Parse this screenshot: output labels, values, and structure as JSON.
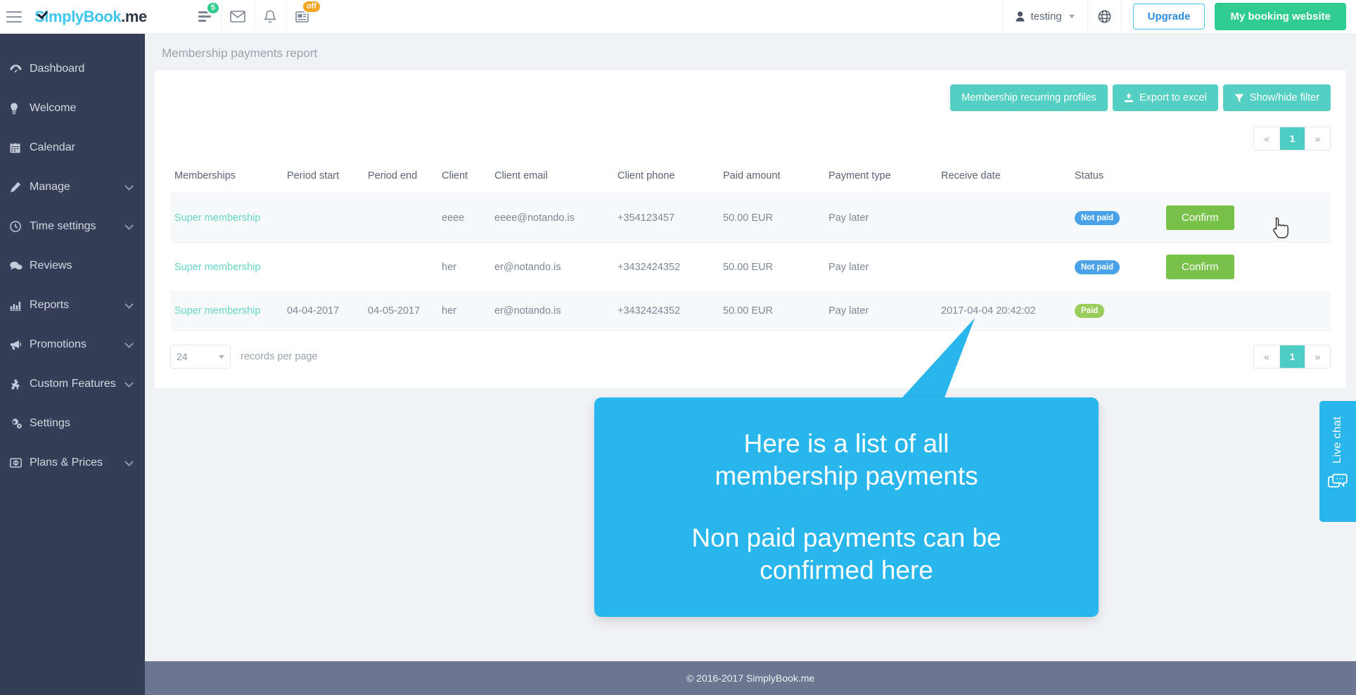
{
  "header": {
    "logo": {
      "s": "S",
      "blue": "imply",
      "bold_blue": "Book",
      "dark": ".me"
    },
    "icons": [
      {
        "name": "list-icon",
        "badge": "5",
        "badge_color": "#2ecc8f"
      },
      {
        "name": "envelope-icon",
        "badge": ""
      },
      {
        "name": "bell-icon",
        "badge": ""
      },
      {
        "name": "news-icon",
        "badge": "off",
        "badge_color": "#f5a623"
      }
    ],
    "user": "testing",
    "upgrade_label": "Upgrade",
    "booking_label": "My booking website"
  },
  "sidebar": {
    "items": [
      {
        "label": "Dashboard",
        "icon": "dashboard-icon",
        "chevron": false
      },
      {
        "label": "Welcome",
        "icon": "bulb-icon",
        "chevron": false
      },
      {
        "label": "Calendar",
        "icon": "calendar-icon",
        "chevron": false
      },
      {
        "label": "Manage",
        "icon": "pencil-icon",
        "chevron": true
      },
      {
        "label": "Time settings",
        "icon": "clock-icon",
        "chevron": true
      },
      {
        "label": "Reviews",
        "icon": "comment-icon",
        "chevron": false
      },
      {
        "label": "Reports",
        "icon": "chart-icon",
        "chevron": true
      },
      {
        "label": "Promotions",
        "icon": "megaphone-icon",
        "chevron": true
      },
      {
        "label": "Custom Features",
        "icon": "puzzle-icon",
        "chevron": true
      },
      {
        "label": "Settings",
        "icon": "gears-icon",
        "chevron": false
      },
      {
        "label": "Plans & Prices",
        "icon": "card-icon",
        "chevron": true
      }
    ]
  },
  "page": {
    "title": "Membership payments report"
  },
  "toolbar": {
    "recurring_profiles_label": "Membership recurring profiles",
    "export_label": "Export to excel",
    "filter_label": "Show/hide filter"
  },
  "pagination": {
    "prev": "«",
    "current": "1",
    "next": "»"
  },
  "table": {
    "columns": [
      "Memberships",
      "Period start",
      "Period end",
      "Client",
      "Client email",
      "Client phone",
      "Paid amount",
      "Payment type",
      "Receive date",
      "Status",
      ""
    ],
    "rows": [
      {
        "membership": "Super membership",
        "period_start": "",
        "period_end": "",
        "client": "eeee",
        "client_email": "eeee@notando.is",
        "client_phone": "+354123457",
        "paid_amount": "50.00 EUR",
        "payment_type": "Pay later",
        "receive_date": "",
        "status": "Not paid",
        "status_kind": "notpaid",
        "action": "Confirm"
      },
      {
        "membership": "Super membership",
        "period_start": "",
        "period_end": "",
        "client": "her",
        "client_email": "er@notando.is",
        "client_phone": "+3432424352",
        "paid_amount": "50.00 EUR",
        "payment_type": "Pay later",
        "receive_date": "",
        "status": "Not paid",
        "status_kind": "notpaid",
        "action": "Confirm"
      },
      {
        "membership": "Super membership",
        "period_start": "04-04-2017",
        "period_end": "04-05-2017",
        "client": "her",
        "client_email": "er@notando.is",
        "client_phone": "+3432424352",
        "paid_amount": "50.00 EUR",
        "payment_type": "Pay later",
        "receive_date": "2017-04-04 20:42:02",
        "status": "Paid",
        "status_kind": "paid",
        "action": ""
      }
    ]
  },
  "records_per_page": {
    "value": "24",
    "label": "records per page"
  },
  "callout": {
    "line1": "Here is a list of all",
    "line2": "membership payments",
    "line3": "Non paid payments can be",
    "line4": "confirmed here",
    "color": "#29b6ec"
  },
  "livechat": {
    "label": "Live chat"
  },
  "footer": {
    "text": "© 2016-2017 SimplyBook.me"
  },
  "colors": {
    "sidebar": "#343f57",
    "accent_teal": "#53cfc3",
    "accent_green": "#2ecc8f",
    "confirm_green": "#79c24a",
    "notpaid_blue": "#4aa3e8",
    "paid_green": "#9acd5c",
    "callout_blue": "#29b6ec",
    "footer": "#6c7691"
  }
}
